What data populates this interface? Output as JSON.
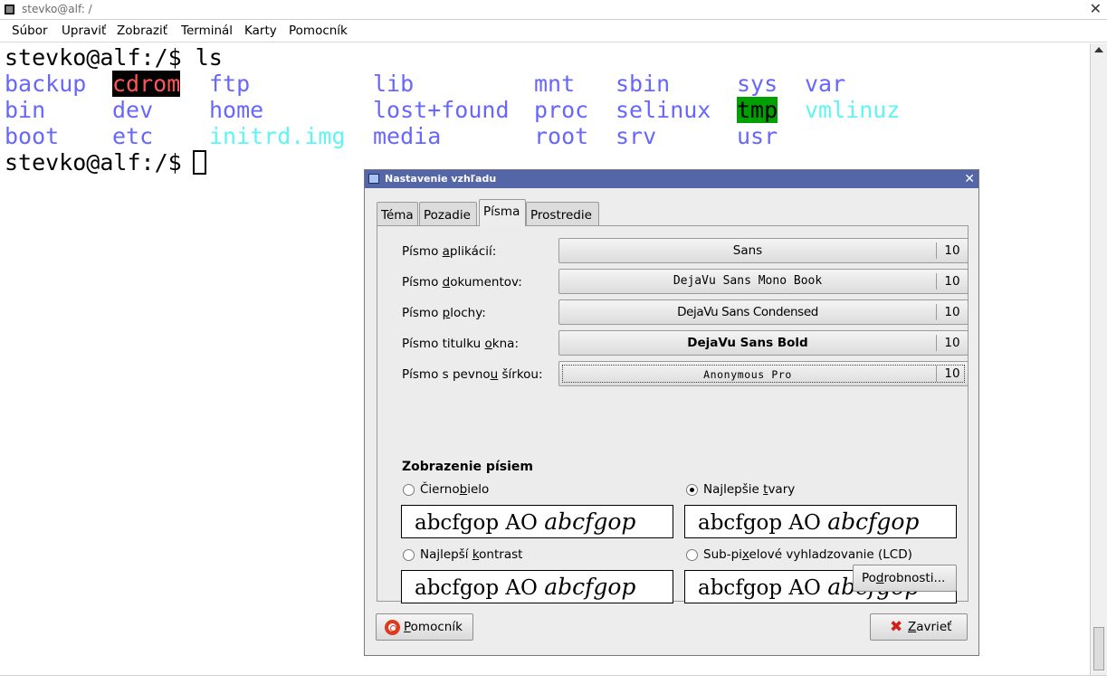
{
  "window": {
    "title": "stevko@alf: /",
    "close_glyph": "✕"
  },
  "menu": [
    "Súbor",
    "Upraviť",
    "Zobraziť",
    "Terminál",
    "Karty",
    "Pomocník"
  ],
  "terminal": {
    "prompt_line1": "stevko@alf:/$ ls",
    "prompt_line2": "stevko@alf:/$ ",
    "entries": [
      {
        "name": "backup",
        "type": "dir"
      },
      {
        "name": "cdrom",
        "type": "highlight-black"
      },
      {
        "name": "ftp",
        "type": "dir"
      },
      {
        "name": "lib",
        "type": "dir"
      },
      {
        "name": "mnt",
        "type": "dir"
      },
      {
        "name": "sbin",
        "type": "dir"
      },
      {
        "name": "sys",
        "type": "dir"
      },
      {
        "name": "var",
        "type": "dir"
      },
      {
        "name": "bin",
        "type": "dir"
      },
      {
        "name": "dev",
        "type": "dir"
      },
      {
        "name": "home",
        "type": "dir"
      },
      {
        "name": "lost+found",
        "type": "dir"
      },
      {
        "name": "proc",
        "type": "dir"
      },
      {
        "name": "selinux",
        "type": "dir"
      },
      {
        "name": "tmp",
        "type": "highlight-green"
      },
      {
        "name": "vmlinuz",
        "type": "link"
      },
      {
        "name": "boot",
        "type": "dir"
      },
      {
        "name": "etc",
        "type": "dir"
      },
      {
        "name": "initrd.img",
        "type": "link"
      },
      {
        "name": "media",
        "type": "dir"
      },
      {
        "name": "root",
        "type": "dir"
      },
      {
        "name": "srv",
        "type": "dir"
      },
      {
        "name": "usr",
        "type": "dir"
      }
    ],
    "colors": {
      "dir": "#6767ff",
      "link": "#5ff5f5",
      "cdrom_fg": "#ff5555",
      "cdrom_bg": "#000000",
      "tmp_bg": "#00a000"
    }
  },
  "dialog": {
    "title": "Nastavenie vzhľadu",
    "close_glyph": "✕",
    "tabs": [
      "Téma",
      "Pozadie",
      "Písma",
      "Prostredie"
    ],
    "active_tab": "Písma",
    "fonts": [
      {
        "label_pre": "Písmo ",
        "label_u": "a",
        "label_post": "plikácií:",
        "font": "Sans",
        "size": "10"
      },
      {
        "label_pre": "Písmo ",
        "label_u": "d",
        "label_post": "okumentov:",
        "font": "DejaVu Sans Mono Book",
        "size": "10"
      },
      {
        "label_pre": "Písmo ",
        "label_u": "p",
        "label_post": "lochy:",
        "font": "DejaVu Sans Condensed",
        "size": "10"
      },
      {
        "label_pre": "Písmo titulku ",
        "label_u": "o",
        "label_post": "kna:",
        "font": "DejaVu Sans Bold",
        "size": "10"
      },
      {
        "label_pre": "Písmo s pevno",
        "label_u": "u",
        "label_post": " šírkou:",
        "font": "Anonymous Pro",
        "size": "10"
      }
    ],
    "rendering": {
      "heading": "Zobrazenie písiem",
      "options": [
        {
          "pre": "Čierno",
          "u": "b",
          "post": "ielo",
          "checked": false
        },
        {
          "pre": "Najlepšie ",
          "u": "t",
          "post": "vary",
          "checked": true
        },
        {
          "pre": "Najlepší ",
          "u": "k",
          "post": "ontrast",
          "checked": false
        },
        {
          "pre": "Sub-pi",
          "u": "x",
          "post": "elové vyhladzovanie (LCD)",
          "checked": false
        }
      ],
      "preview_text": "abcfgop AO ",
      "preview_italic": "abcfgop"
    },
    "details_button": {
      "pre": "Po",
      "u": "d",
      "post": "robnosti..."
    },
    "help_button": {
      "pre": "",
      "u": "P",
      "post": "omocník",
      "icon": "lifebuoy-icon"
    },
    "close_button": {
      "pre": "",
      "u": "Z",
      "post": "avrieť",
      "icon": "close-x-icon"
    }
  }
}
